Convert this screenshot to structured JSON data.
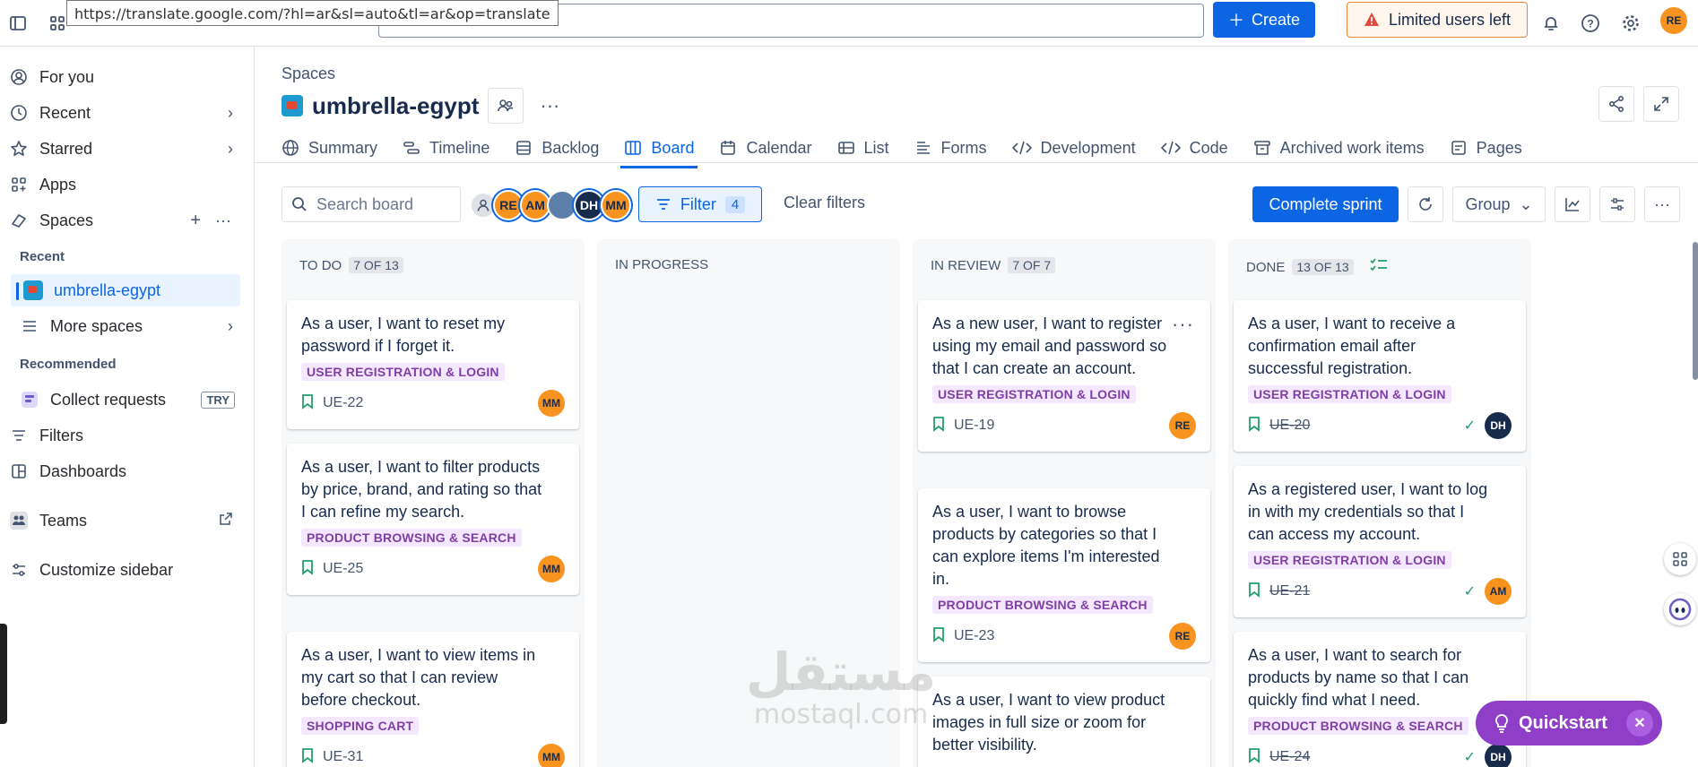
{
  "browser": {
    "url_tooltip": "https://translate.google.com/?hl=ar&sl=auto&tl=ar&op=translate"
  },
  "topbar": {
    "create_label": "Create",
    "limited_label": "Limited users left",
    "user_initials": "RE"
  },
  "sidebar": {
    "for_you": "For you",
    "recent": "Recent",
    "starred": "Starred",
    "apps": "Apps",
    "spaces": "Spaces",
    "section_recent": "Recent",
    "recent_space": "umbrella-egypt",
    "more_spaces": "More spaces",
    "section_recommended": "Recommended",
    "collect_requests": "Collect requests",
    "try_badge": "TRY",
    "filters": "Filters",
    "dashboards": "Dashboards",
    "teams": "Teams",
    "customize": "Customize sidebar"
  },
  "header": {
    "breadcrumb": "Spaces",
    "title": "umbrella-egypt",
    "tabs": [
      {
        "label": "Summary",
        "icon": "globe-icon"
      },
      {
        "label": "Timeline",
        "icon": "timeline-icon"
      },
      {
        "label": "Backlog",
        "icon": "backlog-icon"
      },
      {
        "label": "Board",
        "icon": "board-icon"
      },
      {
        "label": "Calendar",
        "icon": "calendar-icon"
      },
      {
        "label": "List",
        "icon": "list-icon"
      },
      {
        "label": "Forms",
        "icon": "forms-icon"
      },
      {
        "label": "Development",
        "icon": "code-icon"
      },
      {
        "label": "Code",
        "icon": "code-icon"
      },
      {
        "label": "Archived work items",
        "icon": "archive-icon"
      },
      {
        "label": "Pages",
        "icon": "page-icon"
      }
    ],
    "active_tab": "Board"
  },
  "toolbar": {
    "search_placeholder": "Search board",
    "avatars": [
      "RE",
      "AM",
      "DH",
      "MM"
    ],
    "filter_label": "Filter",
    "filter_count": "4",
    "clear_filters": "Clear filters",
    "complete_sprint": "Complete sprint",
    "group_label": "Group"
  },
  "columns": [
    {
      "name": "TO DO",
      "count": "7 OF 13",
      "cards": [
        {
          "text": "As a user, I want to reset my password if I forget it.",
          "label": "USER REGISTRATION & LOGIN",
          "key": "UE-22",
          "assignee": "MM",
          "done": false
        },
        {
          "text": "As a user, I want to filter products by price, brand, and rating so that I can refine my search.",
          "label": "PRODUCT BROWSING & SEARCH",
          "key": "UE-25",
          "assignee": "MM",
          "done": false
        },
        {
          "text": "As a user, I want to view items in my cart so that I can review before checkout.",
          "label": "SHOPPING CART",
          "key": "UE-31",
          "assignee": "MM",
          "done": false
        }
      ]
    },
    {
      "name": "IN PROGRESS",
      "count": "",
      "cards": []
    },
    {
      "name": "IN REVIEW",
      "count": "7 OF 7",
      "cards": [
        {
          "text": "As a new user, I want to register using my email and password so that I can create an account.",
          "label": "USER REGISTRATION & LOGIN",
          "key": "UE-19",
          "assignee": "RE",
          "done": false
        },
        {
          "text": "As a user, I want to browse products by categories so that I can explore items I'm interested in.",
          "label": "PRODUCT BROWSING & SEARCH",
          "key": "UE-23",
          "assignee": "RE",
          "done": false
        },
        {
          "text": "As a user, I want to view product images in full size or zoom for better visibility.",
          "label": "",
          "key": "",
          "assignee": "",
          "done": false
        }
      ]
    },
    {
      "name": "DONE",
      "count": "13 OF 13",
      "cards": [
        {
          "text": "As a user, I want to receive a confirmation email after successful registration.",
          "label": "USER REGISTRATION & LOGIN",
          "key": "UE-20",
          "assignee": "DH",
          "done": true
        },
        {
          "text": "As a registered user, I want to log in with my credentials so that I can access my account.",
          "label": "USER REGISTRATION & LOGIN",
          "key": "UE-21",
          "assignee": "AM",
          "done": true
        },
        {
          "text": "As a user, I want to search for products by name so that I can quickly find what I need.",
          "label": "PRODUCT BROWSING & SEARCH",
          "key": "UE-24",
          "assignee": "DH",
          "done": true
        }
      ]
    }
  ],
  "quickstart": {
    "label": "Quickstart"
  },
  "watermark": {
    "arabic": "مستقل",
    "latin": "mostaql.com"
  },
  "colors": {
    "accent": "#0c66e4",
    "label_bg": "#f3e8fd",
    "label_fg": "#803fa5",
    "avatar_orange": "#f7931e",
    "avatar_dark": "#172b4d",
    "quickstart": "#8f3fc7"
  }
}
